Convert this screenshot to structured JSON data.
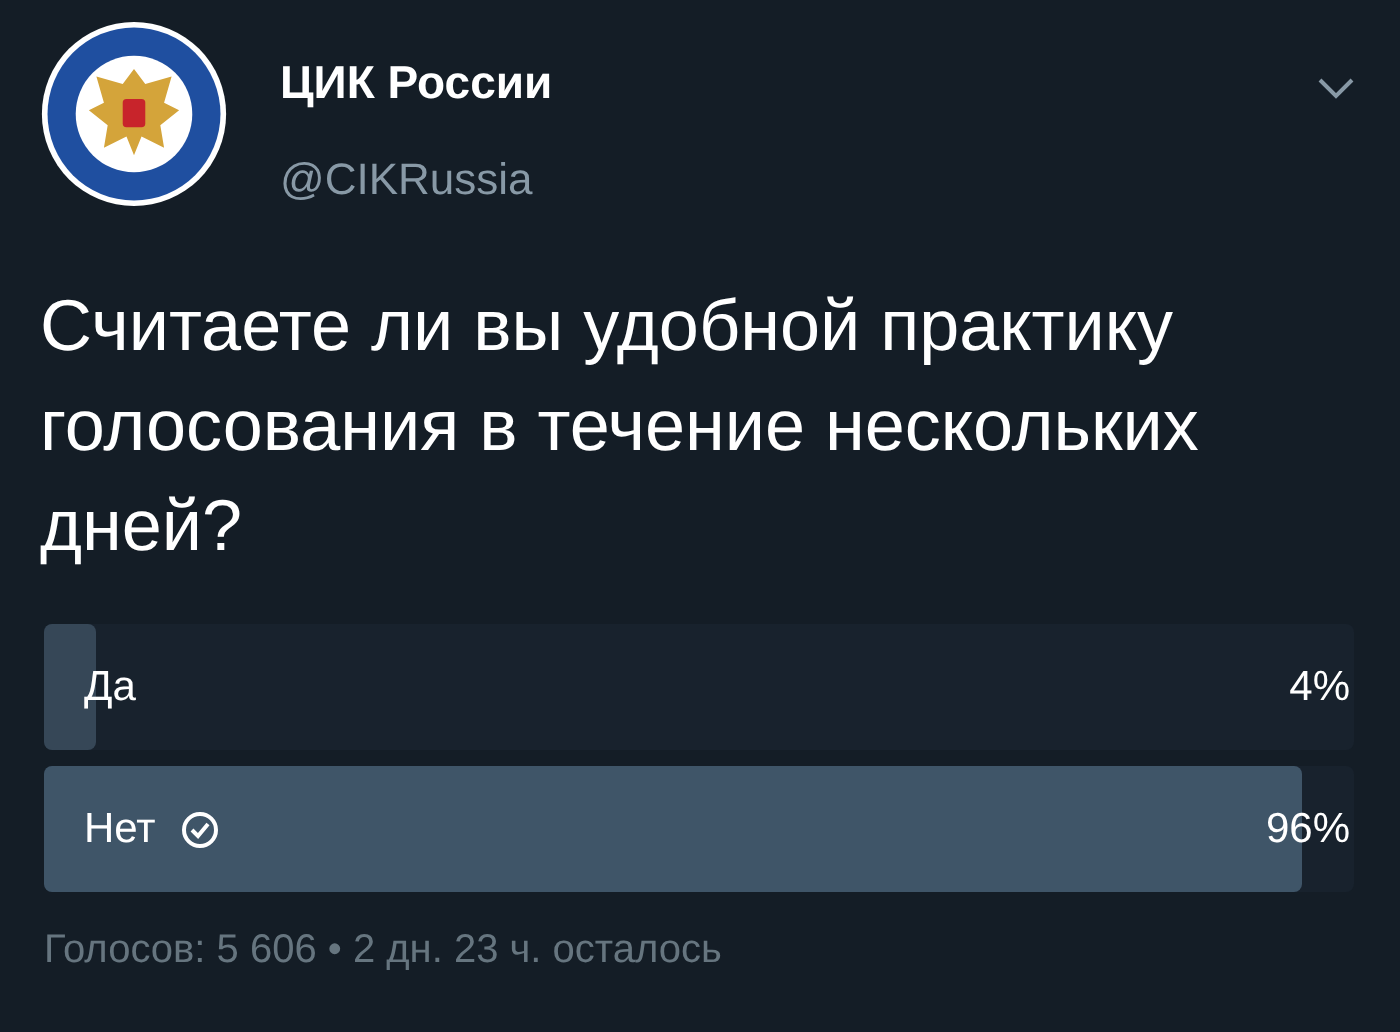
{
  "author": {
    "name": "ЦИК России",
    "handle": "@CIKRussia"
  },
  "question": "Считаете ли вы удобной практику голосования в течение нескольких дней?",
  "poll": {
    "options": [
      {
        "label": "Да",
        "percent": "4%",
        "level": 0.04,
        "selected": false
      },
      {
        "label": "Нет",
        "percent": "96%",
        "level": 0.96,
        "selected": true
      }
    ],
    "footer": "Голосов: 5 606 • 2 дн. 23 ч. осталось"
  }
}
